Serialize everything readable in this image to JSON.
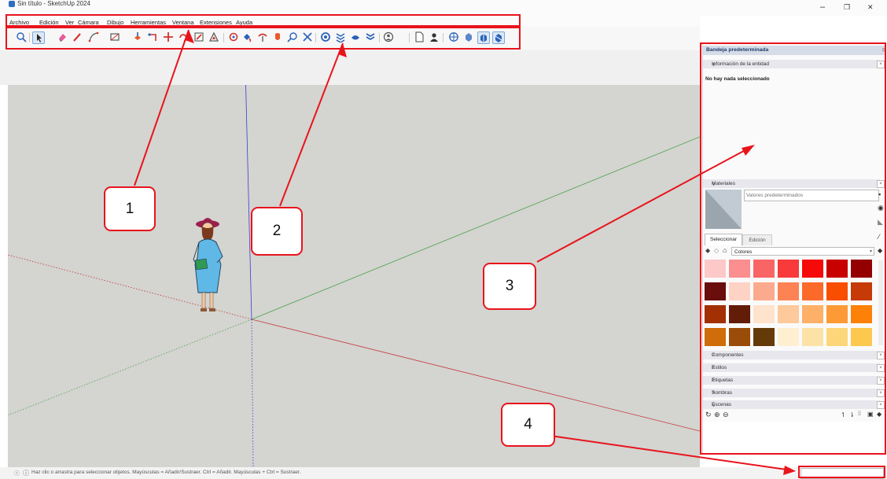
{
  "window": {
    "title": "Sin título - SketchUp 2024",
    "minimize": "–",
    "maximize": "❐",
    "close": "✕"
  },
  "menu": [
    "Archivo",
    "Edición",
    "Ver",
    "Cámara",
    "Dibujo",
    "Herramientas",
    "Ventana",
    "Extensiones",
    "Ayuda"
  ],
  "status": {
    "hint": "Haz clic o arrastra para seleccionar objetos. Mayúsculas = Añadir/Sustraer. Ctrl = Añadir. Mayúsculas + Ctrl = Sustraer."
  },
  "tray": {
    "title": "Bandeja predeterminada",
    "entity_info": {
      "header": "Información de la entidad",
      "message": "No hay nada seleccionado"
    },
    "materials": {
      "header": "Materiales",
      "name_placeholder": "Valores predeterminados",
      "tabs": [
        "Seleccionar",
        "Edición"
      ],
      "library": "Colores",
      "swatches": [
        "#fcc8c8",
        "#fb8e8e",
        "#f96565",
        "#f83a3a",
        "#f60909",
        "#c80000",
        "#940000",
        "#690d0d",
        "#fed2c4",
        "#fcaa8d",
        "#fd8355",
        "#fc6a29",
        "#f94d00",
        "#c53a06",
        "#a33002",
        "#621c08",
        "#fee3cd",
        "#fec99b",
        "#feb068",
        "#fd9a36",
        "#fd8007",
        "#ce6d09",
        "#9a4c09",
        "#643a09",
        "#fdefd0",
        "#fde2a8",
        "#fdd67a",
        "#fcc94e"
      ]
    },
    "collapsed_panels": [
      "Componentes",
      "Estilos",
      "Etiquetas",
      "Sombras"
    ],
    "scenes": {
      "header": "Escenas"
    }
  },
  "callouts": [
    "1",
    "2",
    "3",
    "4"
  ],
  "colors": {
    "annotation_red": "#e8141c",
    "axis_red": "#c23b3b",
    "axis_green": "#4aa34a",
    "axis_blue": "#3b3bd9",
    "viewport_ground": "#d4d4d0"
  }
}
